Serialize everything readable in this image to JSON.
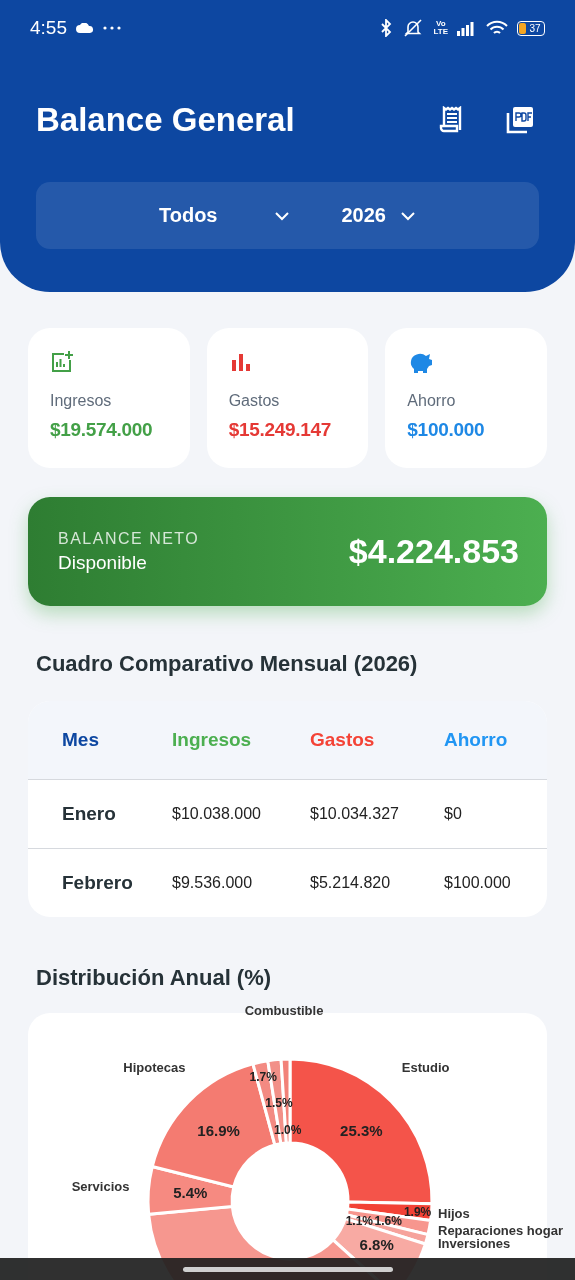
{
  "status_bar": {
    "time": "4:55",
    "network": [
      "Vo",
      "LTE"
    ],
    "battery": "37"
  },
  "header": {
    "title": "Balance General",
    "filters": [
      {
        "label": "Todos"
      },
      {
        "label": "2026"
      }
    ]
  },
  "summary_cards": [
    {
      "kind": "income",
      "label": "Ingresos",
      "value": "$19.574.000",
      "color": "#43a047"
    },
    {
      "kind": "expense",
      "label": "Gastos",
      "value": "$15.249.147",
      "color": "#e53935"
    },
    {
      "kind": "savings",
      "label": "Ahorro",
      "value": "$100.000",
      "color": "#1e88e5"
    }
  ],
  "balance": {
    "title": "BALANCE NETO",
    "subtitle": "Disponible",
    "value": "$4.224.853"
  },
  "table": {
    "title": "Cuadro Comparativo Mensual (2026)",
    "columns": [
      {
        "label": "Mes",
        "color": "#0d47a1"
      },
      {
        "label": "Ingresos",
        "color": "#4caf50"
      },
      {
        "label": "Gastos",
        "color": "#f44336"
      },
      {
        "label": "Ahorro",
        "color": "#2196f3"
      }
    ],
    "rows": [
      [
        "Enero",
        "$10.038.000",
        "$10.034.327",
        "$0"
      ],
      [
        "Febrero",
        "$9.536.000",
        "$5.214.820",
        "$100.000"
      ]
    ]
  },
  "distribution": {
    "title": "Distribución Anual (%)",
    "chart_data": {
      "type": "donut",
      "categories": [
        "Estudio",
        "Hijos",
        "Reparaciones hogar",
        "Inversiones",
        null,
        null,
        "Servicios",
        "Hipotecas",
        null,
        null,
        "Combustible"
      ],
      "values": [
        25.3,
        1.9,
        1.6,
        1.1,
        6.8,
        36.8,
        5.4,
        16.9,
        1.7,
        1.5,
        1.0
      ],
      "value_labels": [
        "25.3%",
        "1.9%",
        "1.6%",
        "1.1%",
        "6.8%",
        null,
        "5.4%",
        "16.9%",
        "1.7%",
        "1.5%",
        "1.0%"
      ],
      "data_labels": true
    }
  }
}
